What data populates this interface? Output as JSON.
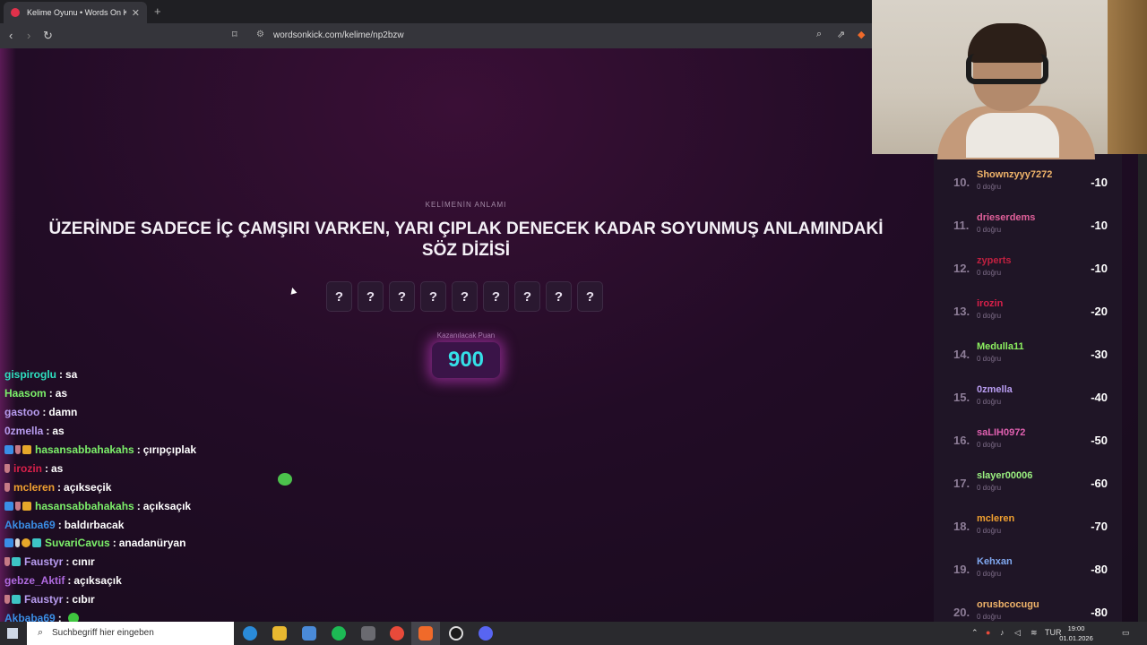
{
  "browser": {
    "tab_title": "Kelime Oyunu • Words On Kick",
    "url": "wordsonkick.com/kelime/np2bzw"
  },
  "game": {
    "meaning_label": "KELİMENİN ANLAMI",
    "definition": "ÜZERİNDE SADECE İÇ ÇAMŞIRI VARKEN, YARI ÇIPLAK DENECEK KADAR SOYUNMUŞ ANLAMINDAKİ SÖZ DİZİSİ",
    "tiles": [
      "?",
      "?",
      "?",
      "?",
      "?",
      "?",
      "?",
      "?",
      "?"
    ],
    "points_label": "Kazanılacak Puan",
    "points": "900"
  },
  "chat": {
    "messages": [
      {
        "user": "gispiroglu",
        "color": "#2ee0c0",
        "text": "sa",
        "badges": []
      },
      {
        "user": "Haasom",
        "color": "#7cf06a",
        "text": "as",
        "badges": []
      },
      {
        "user": "gastoo",
        "color": "#b89cf0",
        "text": "damn",
        "badges": []
      },
      {
        "user": "0zmella",
        "color": "#b89cf0",
        "text": "as",
        "badges": []
      },
      {
        "user": "hasansabbahakahs",
        "color": "#7cf06a",
        "text": "çırıpçıplak",
        "badges": [
          "tw",
          "cup",
          "crown"
        ]
      },
      {
        "user": "irozin",
        "color": "#d8204a",
        "text": "as",
        "badges": [
          "cup"
        ]
      },
      {
        "user": "mcleren",
        "color": "#f0a030",
        "text": "açıkseçik",
        "badges": [
          "cup"
        ]
      },
      {
        "user": "hasansabbahakahs",
        "color": "#7cf06a",
        "text": "açıksaçık",
        "badges": [
          "tw",
          "cup",
          "crown"
        ]
      },
      {
        "user": "Akbaba69",
        "color": "#3a8ee6",
        "text": "baldırbacak",
        "badges": []
      },
      {
        "user": "SuvariCavus",
        "color": "#7cf06a",
        "text": "anadanüryan",
        "badges": [
          "tw",
          "mic",
          "one",
          "gift"
        ]
      },
      {
        "user": "Faustyr",
        "color": "#b89cf0",
        "text": "cınır",
        "badges": [
          "cup",
          "gift"
        ]
      },
      {
        "user": "gebze_Aktif",
        "color": "#b06ae0",
        "text": "açıksaçık",
        "badges": []
      },
      {
        "user": "Faustyr",
        "color": "#b89cf0",
        "text": "cıbır",
        "badges": [
          "cup",
          "gift"
        ]
      },
      {
        "user": "Akbaba69",
        "color": "#3a8ee6",
        "text": "",
        "badges": [],
        "emote": true
      }
    ]
  },
  "leaderboard": {
    "rows": [
      {
        "rank": "10.",
        "name": "Shownzyyy7272",
        "color": "#f0b46a",
        "correct": "0 doğru",
        "score": "-10"
      },
      {
        "rank": "11.",
        "name": "drieserdems",
        "color": "#e0609a",
        "correct": "0 doğru",
        "score": "-10"
      },
      {
        "rank": "12.",
        "name": "zyperts",
        "color": "#c02040",
        "correct": "0 doğru",
        "score": "-10"
      },
      {
        "rank": "13.",
        "name": "irozin",
        "color": "#d8204a",
        "correct": "0 doğru",
        "score": "-20"
      },
      {
        "rank": "14.",
        "name": "Medulla11",
        "color": "#8cf060",
        "correct": "0 doğru",
        "score": "-30"
      },
      {
        "rank": "15.",
        "name": "0zmella",
        "color": "#b89cf0",
        "correct": "0 doğru",
        "score": "-40"
      },
      {
        "rank": "16.",
        "name": "saLIH0972",
        "color": "#e060b0",
        "correct": "0 doğru",
        "score": "-50"
      },
      {
        "rank": "17.",
        "name": "slayer00006",
        "color": "#9af080",
        "correct": "0 doğru",
        "score": "-60"
      },
      {
        "rank": "18.",
        "name": "mcleren",
        "color": "#f0a030",
        "correct": "0 doğru",
        "score": "-70"
      },
      {
        "rank": "19.",
        "name": "Kehxan",
        "color": "#80a8f0",
        "correct": "0 doğru",
        "score": "-80"
      },
      {
        "rank": "20.",
        "name": "orusbcocugu",
        "color": "#f0b46a",
        "correct": "0 doğru",
        "score": "-80"
      }
    ]
  },
  "taskbar": {
    "search_placeholder": "Suchbegriff hier eingeben",
    "lang": "TUR",
    "time": "19:00",
    "date": "01.01.2026"
  }
}
